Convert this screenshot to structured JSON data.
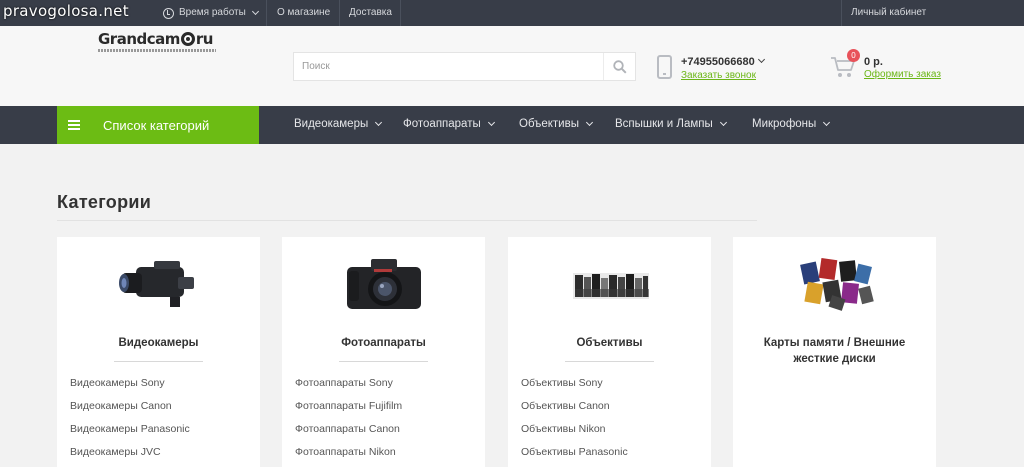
{
  "watermark": "pravogolosa.net",
  "topbar": {
    "time_label": "Время работы",
    "about": "О магазине",
    "delivery": "Доставка",
    "account": "Личный кабинет"
  },
  "header": {
    "logo_left": "Grandcam",
    "logo_right": "ru",
    "search_placeholder": "Поиск",
    "phone": "+74955066680",
    "callback": "Заказать звонок",
    "cart_count": "0",
    "cart_sum": "0 р.",
    "checkout": "Оформить заказ"
  },
  "nav": {
    "categories_button": "Список категорий",
    "items": [
      "Видеокамеры",
      "Фотоаппараты",
      "Объективы",
      "Вспышки и Лампы",
      "Микрофоны"
    ]
  },
  "main": {
    "title": "Категории",
    "cards": [
      {
        "name": "Видеокамеры",
        "subs": [
          "Видеокамеры Sony",
          "Видеокамеры Canon",
          "Видеокамеры Panasonic",
          "Видеокамеры JVC"
        ]
      },
      {
        "name": "Фотоаппараты",
        "subs": [
          "Фотоаппараты Sony",
          "Фотоаппараты Fujifilm",
          "Фотоаппараты Canon",
          "Фотоаппараты Nikon"
        ]
      },
      {
        "name": "Объективы",
        "subs": [
          "Объективы Sony",
          "Объективы Canon",
          "Объективы Nikon",
          "Объективы Panasonic"
        ]
      },
      {
        "name": "Карты памяти / Внешние жесткие диски",
        "subs": []
      }
    ]
  },
  "colors": {
    "dark_bar": "#383d48",
    "accent_green": "#6cbc14",
    "link_green": "#6bb616",
    "badge_red": "#e8525a"
  },
  "icons": [
    "clock-icon",
    "search-icon",
    "phone-icon",
    "cart-icon",
    "menu-icon",
    "chevron-down-icon"
  ]
}
